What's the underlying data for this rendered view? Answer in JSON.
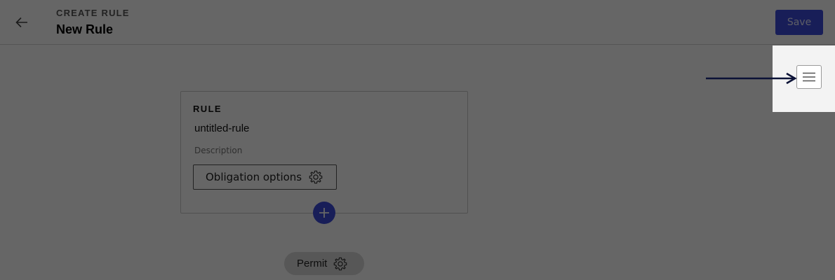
{
  "header": {
    "back_icon": "arrow-left-icon",
    "subtitle": "CREATE RULE",
    "title": "New Rule",
    "save_label": "Save"
  },
  "rule_card": {
    "label": "RULE",
    "name": "untitled-rule",
    "description_placeholder": "Description",
    "obligation_label": "Obligation options",
    "obligation_icon": "gear-icon",
    "add_icon": "plus-icon"
  },
  "permit": {
    "label": "Permit",
    "icon": "gear-icon"
  },
  "tour": {
    "highlighted_icon": "hamburger-menu-icon",
    "pointer_icon": "arrow-right-icon"
  },
  "colors": {
    "accent": "#3d4bdb",
    "overlay": "rgba(0,0,0,0.6)",
    "spotlight": "#f3f3f3"
  }
}
